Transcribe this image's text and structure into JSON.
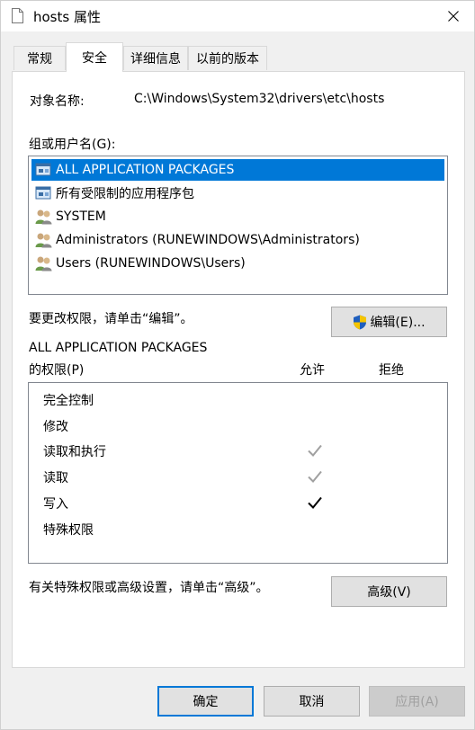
{
  "window": {
    "title": "hosts 属性"
  },
  "tabs": [
    {
      "label": "常规",
      "active": false
    },
    {
      "label": "安全",
      "active": true
    },
    {
      "label": "详细信息",
      "active": false
    },
    {
      "label": "以前的版本",
      "active": false
    }
  ],
  "object": {
    "label": "对象名称:",
    "value": "C:\\Windows\\System32\\drivers\\etc\\hosts"
  },
  "groups": {
    "label": "组或用户名(G):",
    "items": [
      {
        "name": "ALL APPLICATION PACKAGES",
        "icon": "package-group-icon",
        "selected": true
      },
      {
        "name": "所有受限制的应用程序包",
        "icon": "package-group-icon",
        "selected": false
      },
      {
        "name": "SYSTEM",
        "icon": "users-group-icon",
        "selected": false
      },
      {
        "name": "Administrators (RUNEWINDOWS\\Administrators)",
        "icon": "users-group-icon",
        "selected": false
      },
      {
        "name": "Users (RUNEWINDOWS\\Users)",
        "icon": "users-group-icon",
        "selected": false
      }
    ]
  },
  "edit": {
    "hint": "要更改权限，请单击“编辑”。",
    "button_label": "编辑(E)..."
  },
  "permissions": {
    "title": "ALL APPLICATION PACKAGES",
    "label": "的权限(P)",
    "allow_header": "允许",
    "deny_header": "拒绝",
    "rows": [
      {
        "name": "完全控制",
        "allow": "none",
        "deny": "none"
      },
      {
        "name": "修改",
        "allow": "none",
        "deny": "none"
      },
      {
        "name": "读取和执行",
        "allow": "inherited",
        "deny": "none"
      },
      {
        "name": "读取",
        "allow": "inherited",
        "deny": "none"
      },
      {
        "name": "写入",
        "allow": "explicit",
        "deny": "none"
      },
      {
        "name": "特殊权限",
        "allow": "none",
        "deny": "none"
      }
    ]
  },
  "advanced": {
    "hint": "有关特殊权限或高级设置，请单击“高级”。",
    "button_label": "高级(V)"
  },
  "footer": {
    "ok_label": "确定",
    "cancel_label": "取消",
    "apply_label": "应用(A)"
  },
  "colors": {
    "selection": "#0078d7",
    "inherited_check": "#a0a0a0",
    "explicit_check": "#000000"
  }
}
